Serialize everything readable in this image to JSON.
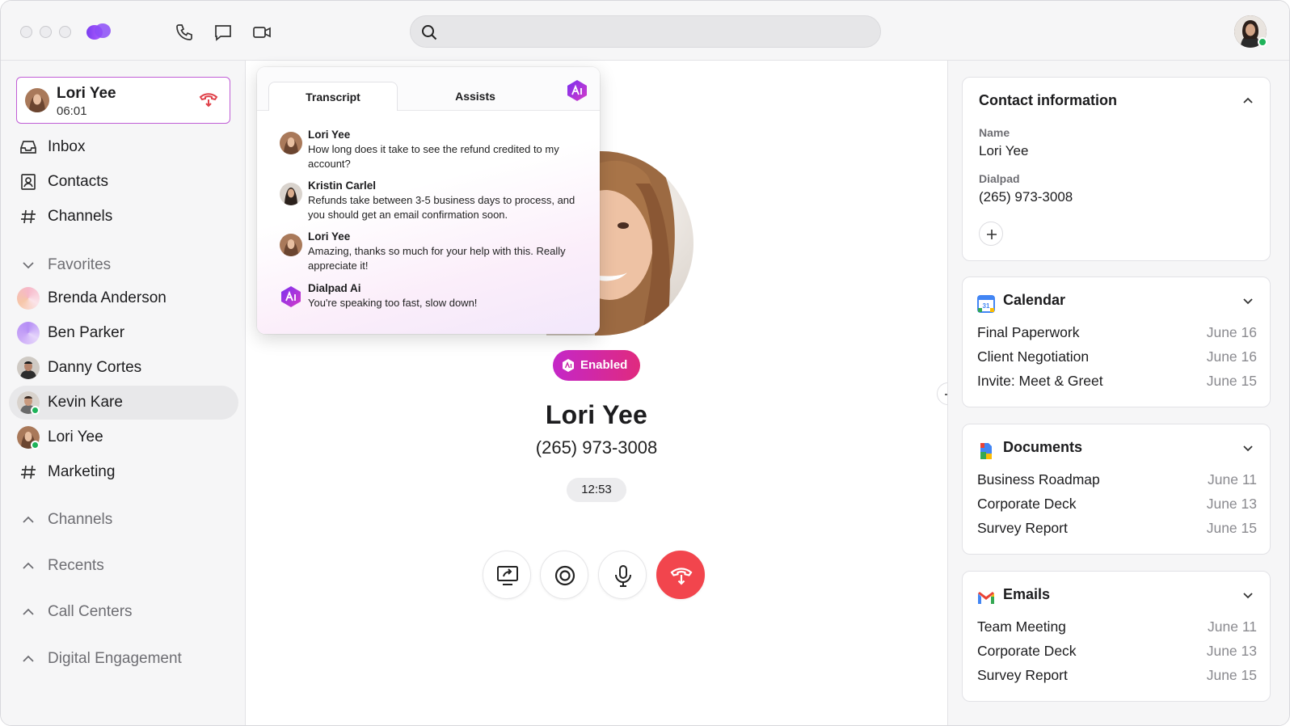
{
  "search": {
    "placeholder": ""
  },
  "colors": {
    "accent": "#c427c8",
    "end_call": "#f2454d",
    "presence": "#1fb35a"
  },
  "active_call": {
    "name": "Lori Yee",
    "duration": "06:01"
  },
  "sidebar": {
    "nav": [
      {
        "label": "Inbox",
        "icon": "inbox-icon"
      },
      {
        "label": "Contacts",
        "icon": "contacts-icon"
      },
      {
        "label": "Channels",
        "icon": "hash-icon"
      }
    ],
    "favorites_label": "Favorites",
    "favorites": [
      {
        "label": "Brenda Anderson"
      },
      {
        "label": "Ben Parker"
      },
      {
        "label": "Danny Cortes"
      },
      {
        "label": "Kevin Kare"
      },
      {
        "label": "Lori Yee"
      },
      {
        "label": "Marketing"
      }
    ],
    "sections": [
      "Channels",
      "Recents",
      "Call Centers",
      "Digital Engagement"
    ]
  },
  "transcript": {
    "tabs": [
      "Transcript",
      "Assists"
    ],
    "messages": [
      {
        "who": "Lori Yee",
        "text": "How long does it take to see the refund credited to my account?"
      },
      {
        "who": "Kristin Carlel",
        "text": "Refunds take between 3-5 business days to process, and you should get an email confirmation soon."
      },
      {
        "who": "Lori Yee",
        "text": "Amazing, thanks so much for your help with this. Really appreciate it!"
      },
      {
        "who": "Dialpad Ai",
        "text": "You're speaking too fast, slow down!"
      }
    ]
  },
  "call": {
    "ai_status": "Enabled",
    "name": "Lori Yee",
    "number": "(265) 973-3008",
    "timer": "12:53"
  },
  "contact_info": {
    "title": "Contact information",
    "name_label": "Name",
    "name_value": "Lori Yee",
    "dialpad_label": "Dialpad",
    "dialpad_value": "(265) 973-3008"
  },
  "calendar": {
    "title": "Calendar",
    "items": [
      {
        "title": "Final Paperwork",
        "date": "June 16"
      },
      {
        "title": "Client Negotiation",
        "date": "June 16"
      },
      {
        "title": "Invite: Meet & Greet",
        "date": "June 15"
      }
    ]
  },
  "documents": {
    "title": "Documents",
    "items": [
      {
        "title": "Business Roadmap",
        "date": "June 11"
      },
      {
        "title": "Corporate Deck",
        "date": "June 13"
      },
      {
        "title": "Survey Report",
        "date": "June 15"
      }
    ]
  },
  "emails": {
    "title": "Emails",
    "items": [
      {
        "title": "Team Meeting",
        "date": "June 11"
      },
      {
        "title": "Corporate Deck",
        "date": "June 13"
      },
      {
        "title": "Survey Report",
        "date": "June 15"
      }
    ]
  }
}
